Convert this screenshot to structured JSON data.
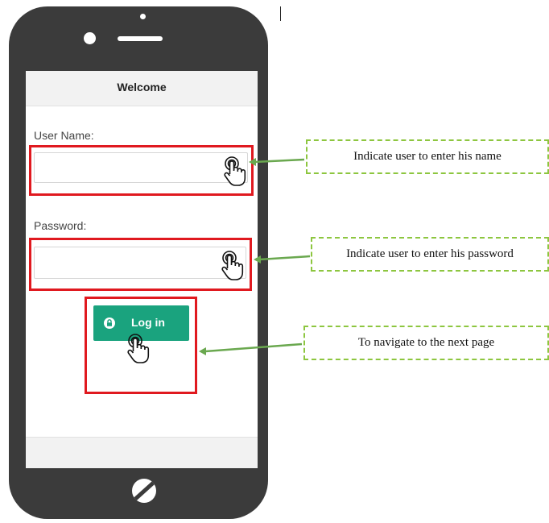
{
  "screen": {
    "title": "Welcome",
    "username_label": "User Name:",
    "password_label": "Password:",
    "username_value": "",
    "password_value": "",
    "login_button_label": "Log in"
  },
  "callouts": {
    "username": "Indicate user to enter his name",
    "password": "Indicate user to enter his password",
    "login": "To navigate to the next page"
  },
  "colors": {
    "phone": "#3b3b3b",
    "highlight": "#e0191f",
    "login_button": "#1aa37e",
    "callout_border": "#8dc63f",
    "arrow": "#6aa84f"
  },
  "icons": {
    "hand": "hand-pointer-icon",
    "lock": "lock-icon"
  }
}
